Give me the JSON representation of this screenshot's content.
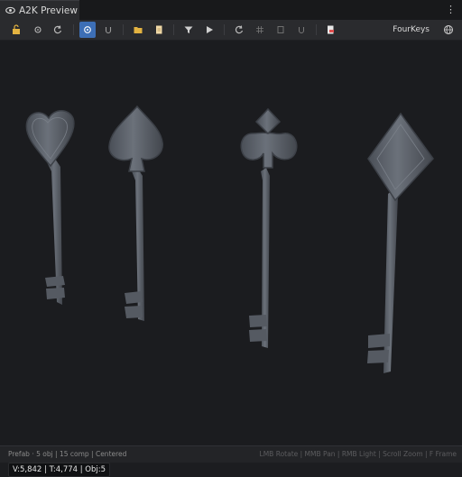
{
  "tab": {
    "title": "A2K Preview"
  },
  "toolbar": {
    "project_name": "FourKeys",
    "buttons": [
      {
        "icon": "lock-open-icon"
      },
      {
        "icon": "reset-icon"
      },
      {
        "icon": "undo-icon"
      },
      {
        "icon": "orbit-icon",
        "active": true
      },
      {
        "icon": "magnet-icon"
      },
      {
        "icon": "folder-icon"
      },
      {
        "icon": "file-icon"
      },
      {
        "icon": "filter-icon"
      },
      {
        "icon": "play-icon"
      },
      {
        "icon": "rotate-icon"
      },
      {
        "icon": "grid-icon"
      },
      {
        "icon": "frame-icon"
      },
      {
        "icon": "snap-icon"
      },
      {
        "icon": "export-icon"
      },
      {
        "icon": "globe-icon"
      }
    ]
  },
  "viewport": {
    "stats": "V:5,842 | T:4,774 | Obj:5"
  },
  "statusbar": {
    "left": "Prefab · 5 obj | 15 comp | Centered",
    "right": "LMB Rotate | MMB Pan | RMB Light | Scroll Zoom | F Frame"
  },
  "colors": {
    "accent": "#3d6fb6",
    "key_metal": "#5d636c",
    "viewport_bg": "#1b1c1f"
  }
}
